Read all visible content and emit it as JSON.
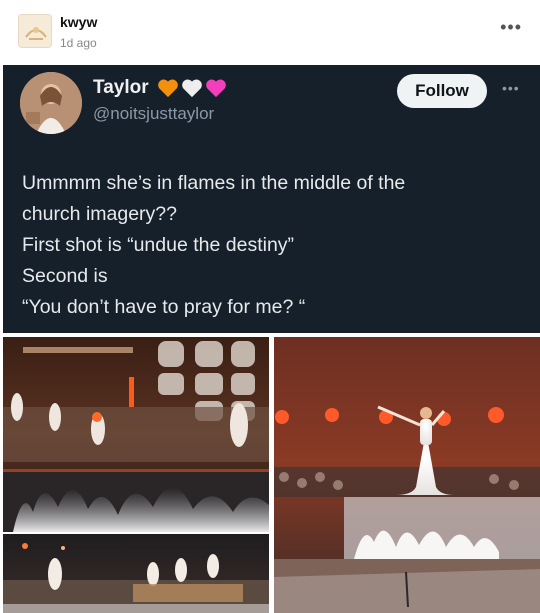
{
  "post": {
    "username": "kwyw",
    "time": "1d ago",
    "more_icon": "ellipsis-icon",
    "more_label": "•••"
  },
  "tweet": {
    "name": "Taylor",
    "hearts": [
      {
        "icon": "orange-heart-icon",
        "color": "#f4900c"
      },
      {
        "icon": "white-heart-icon",
        "color": "#eeeeee"
      },
      {
        "icon": "pink-heart-icon",
        "color": "#f43fbd"
      }
    ],
    "handle": "@noitsjusttaylor",
    "follow_label": "Follow",
    "more_label": "•••",
    "text_lines": [
      "Ummmm she’s in flames in the middle of the",
      "church imagery??",
      "First shot is “undue the destiny”",
      "Second is",
      "“You don’t have to pray for me? “"
    ]
  },
  "colors": {
    "tweet_bg": "#15202b",
    "tweet_text": "#e7e9ea",
    "handle": "#8b98a5",
    "follow_bg": "#eff3f4"
  }
}
